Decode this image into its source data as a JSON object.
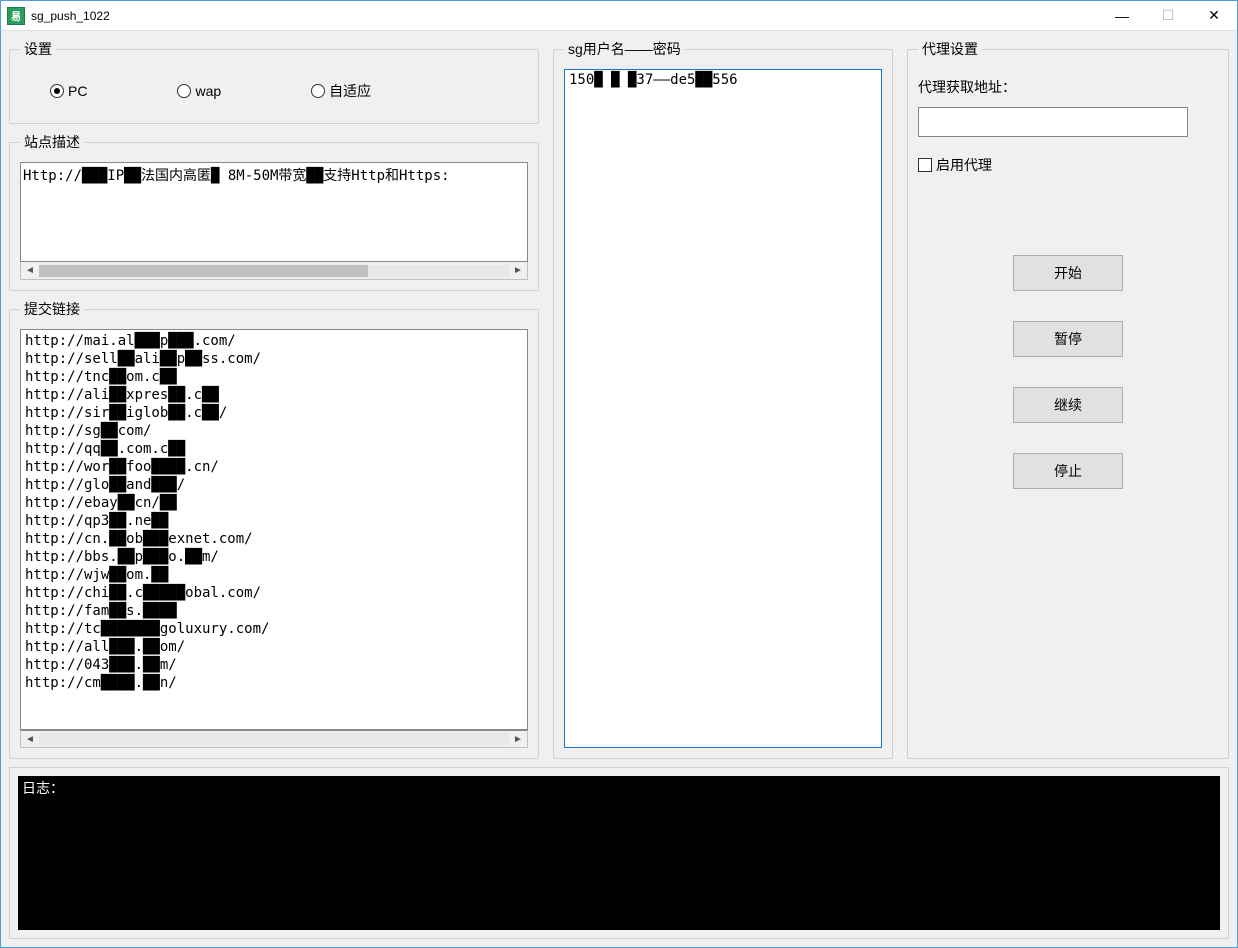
{
  "window": {
    "title": "sg_push_1022",
    "icon_text": "易"
  },
  "settings": {
    "legend": "设置",
    "radios": {
      "pc": "PC",
      "wap": "wap",
      "auto": "自适应"
    },
    "selected": "pc"
  },
  "site_desc": {
    "legend": "站点描述",
    "text": "Http://███IP██法国内高匿█ 8M-50M带宽██支持Http和Https:"
  },
  "submit_links": {
    "legend": "提交链接",
    "lines": [
      "http://mai.al███p███.com/",
      "http://sell██ali██p██ss.com/",
      "http://tnc██om.c██",
      "http://ali██xpres██.c██",
      "http://sir██iglob██.c██/",
      "http://sg██com/",
      "http://qq██.com.c██",
      "http://wor██foo████.cn/",
      "http://glo██and███/",
      "http://ebay██cn/██",
      "http://qp3██.ne██",
      "http://cn.██ob███exnet.com/",
      "http://bbs.██p███o.██m/",
      "http://wjw██om.██",
      "http://chi██.c█████obal.com/",
      "http://fam██s.████",
      "http://tc███████goluxury.com/",
      "http://all███.██om/",
      "http://043███.██m/",
      "http://cm████.██n/"
    ]
  },
  "user_pwd": {
    "legend": "sg用户名——密码",
    "text": "150█ █ █37——de5██556"
  },
  "proxy": {
    "legend": "代理设置",
    "label": "代理获取地址：",
    "input_value": "",
    "checkbox_label": "启用代理",
    "checked": false
  },
  "buttons": {
    "start": "开始",
    "pause": "暂停",
    "resume": "继续",
    "stop": "停止"
  },
  "log": {
    "text": "日志："
  }
}
